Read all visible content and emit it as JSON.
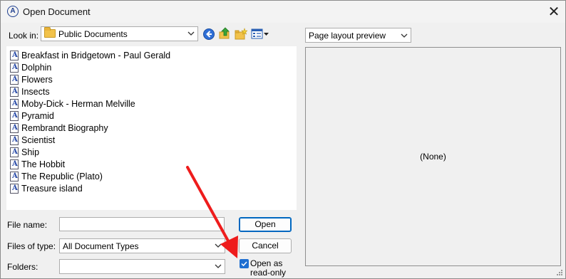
{
  "window": {
    "title": "Open Document",
    "app_icon_glyph": "A",
    "close_glyph": "✕"
  },
  "lookin": {
    "label": "Look in:",
    "value": "Public Documents"
  },
  "toolbar": {
    "icons": [
      "back-icon",
      "up-folder-icon",
      "new-folder-icon",
      "view-menu-icon"
    ]
  },
  "files": [
    "Breakfast in Bridgetown - Paul Gerald",
    "Dolphin",
    "Flowers",
    "Insects",
    "Moby-Dick - Herman Melville",
    "Pyramid",
    "Rembrandt Biography",
    "Scientist",
    "Ship",
    "The Hobbit",
    "The Republic (Plato)",
    "Treasure island"
  ],
  "form": {
    "filename_label": "File name:",
    "filename_value": "",
    "filetype_label": "Files of type:",
    "filetype_value": "All Document Types",
    "folders_label": "Folders:",
    "folders_value": ""
  },
  "buttons": {
    "open": "Open",
    "cancel": "Cancel"
  },
  "readonly": {
    "line1": "Open as",
    "line2": "read-only",
    "checked": true
  },
  "preview": {
    "mode": "Page layout preview",
    "content": "(None)"
  },
  "colors": {
    "accent": "#0067c0",
    "checkbox": "#1f6fd1",
    "annotation_arrow": "#ee1c1c"
  }
}
